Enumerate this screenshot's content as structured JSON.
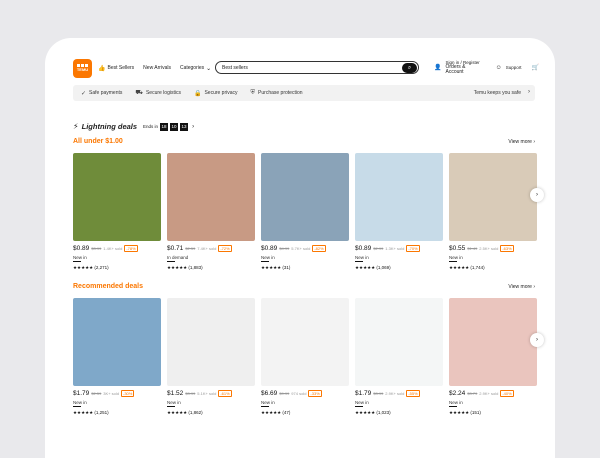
{
  "header": {
    "logo_text": "TEMU",
    "nav": [
      {
        "label": "Best Sellers",
        "icon": "thumb-icon"
      },
      {
        "label": "New Arrivals",
        "icon": ""
      },
      {
        "label": "Categories",
        "icon": "chevron-down-icon"
      }
    ],
    "search": {
      "value": "Best sellers"
    },
    "signin_line1": "Sign in / Register",
    "signin_line2": "Orders & Account",
    "support": "Support"
  },
  "banner": {
    "items": [
      {
        "label": "Safe payments",
        "icon": "check-icon"
      },
      {
        "label": "Secure logistics",
        "icon": "truck-icon"
      },
      {
        "label": "Secure privacy",
        "icon": "lock-icon"
      },
      {
        "label": "Purchase protection",
        "icon": "shield-icon"
      }
    ],
    "right": "Temu keeps you safe"
  },
  "lightning": {
    "title": "Lightning deals",
    "ends_label": "Ends in",
    "timer": [
      "18",
      "10",
      "13"
    ]
  },
  "section1": {
    "title": "All under $1.00",
    "view_more": "View more",
    "products": [
      {
        "price": "$0.89",
        "old": "$3.99",
        "sold": "1.4K+ sold",
        "disc": "-78%",
        "tag": "New in",
        "rating": "★★★★★ (2,271)",
        "bg": "#6f8c3a"
      },
      {
        "price": "$0.71",
        "old": "$2.59",
        "sold": "7.4K+ sold",
        "disc": "-72%",
        "tag": "In demand",
        "rating": "★★★★★ (1,883)",
        "bg": "#c89a84"
      },
      {
        "price": "$0.89",
        "old": "$4.99",
        "sold": "5.7K+ sold",
        "disc": "-82%",
        "tag": "New in",
        "rating": "★★★★★ (31)",
        "bg": "#8aa3b8"
      },
      {
        "price": "$0.89",
        "old": "$2.99",
        "sold": "1.3K+ sold",
        "disc": "-70%",
        "tag": "New in",
        "rating": "★★★★★ (1,069)",
        "bg": "#c7dbe8"
      },
      {
        "price": "$0.55",
        "old": "$1.49",
        "sold": "2.5K+ sold",
        "disc": "-63%",
        "tag": "New in",
        "rating": "★★★★★ (1,744)",
        "bg": "#d9cbb8"
      }
    ]
  },
  "section2": {
    "title": "Recommended deals",
    "view_more": "View more",
    "products": [
      {
        "price": "$1.79",
        "old": "$2.59",
        "sold": "3K+ sold",
        "disc": "-30%",
        "tag": "New in",
        "rating": "★★★★★ (1,251)",
        "bg": "#7fa8c9"
      },
      {
        "price": "$1.52",
        "old": "$3.99",
        "sold": "5.1K+ sold",
        "disc": "-61%",
        "tag": "New in",
        "rating": "★★★★★ (1,862)",
        "bg": "#efefef"
      },
      {
        "price": "$6.69",
        "old": "$9.99",
        "sold": "974 sold",
        "disc": "-33%",
        "tag": "New in",
        "rating": "★★★★★ (47)",
        "bg": "#f3f3f3"
      },
      {
        "price": "$1.79",
        "old": "$3.99",
        "sold": "2.9K+ sold",
        "disc": "-55%",
        "tag": "New in",
        "rating": "★★★★★ (1,023)",
        "bg": "#f4f6f6"
      },
      {
        "price": "$2.24",
        "old": "$3.79",
        "sold": "2.9K+ sold",
        "disc": "-40%",
        "tag": "New in",
        "rating": "★★★★★ (151)",
        "bg": "#eac5be"
      }
    ]
  },
  "colors": {
    "accent": "#fb7701"
  }
}
